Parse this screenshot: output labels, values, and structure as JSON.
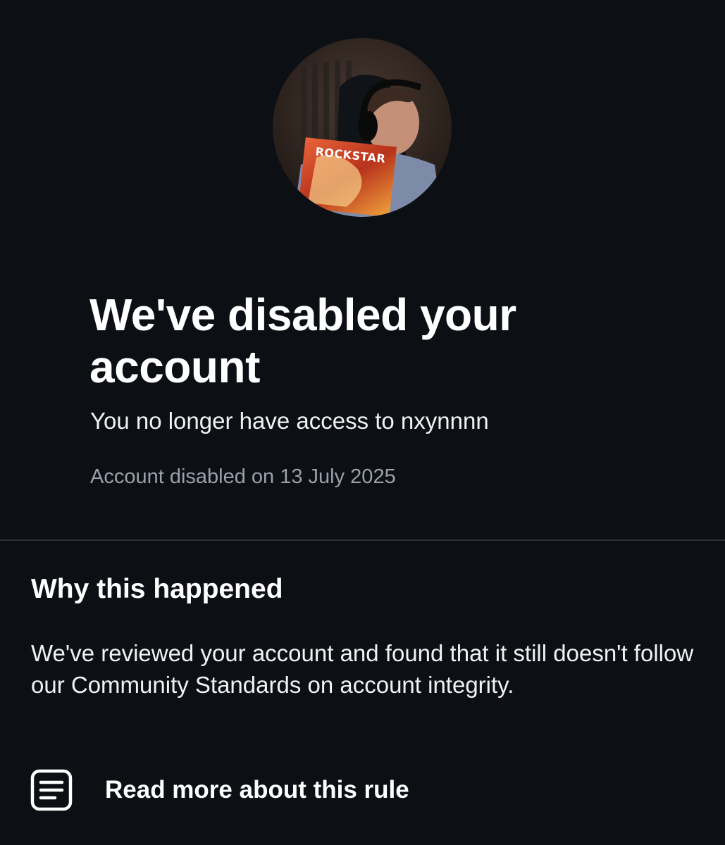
{
  "profile": {
    "avatar_icon": "profile-photo",
    "avatar_caption": "ROCKSTAR"
  },
  "notice": {
    "title": "We've disabled your account",
    "subtitle": "You no longer have access to nxynnnn",
    "disabled_date": "Account disabled on 13 July 2025"
  },
  "why": {
    "heading": "Why this happened",
    "body": "We've reviewed your account and found that it still doesn't follow our Community Standards on account integrity."
  },
  "read_more": {
    "icon": "document-icon",
    "label": "Read more about this rule"
  },
  "colors": {
    "background": "#0c0f14",
    "text_primary": "#ffffff",
    "text_secondary": "#9aa1ab",
    "divider": "#2c3038"
  }
}
